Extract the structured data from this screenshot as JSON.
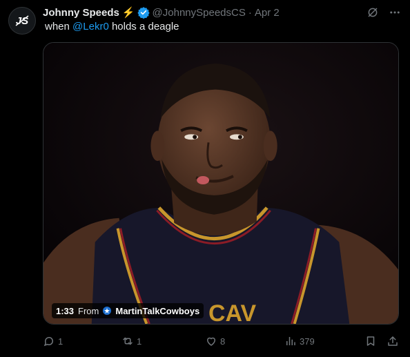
{
  "tweet": {
    "author_name": "Johnny Speeds",
    "author_emoji": "⚡",
    "handle": "@JohnnySpeedsCS",
    "separator": "·",
    "date": "Apr 2",
    "text_before": "when ",
    "mention": "@Lekr0",
    "text_after": " holds a deagle"
  },
  "media": {
    "duration": "1:33",
    "from_label": "From",
    "source_name": "MartinTalkCowboys"
  },
  "actions": {
    "replies": "1",
    "reposts": "1",
    "likes": "8",
    "views": "379"
  },
  "icons": {
    "avatar": "js-logo-icon",
    "verified": "verified-badge-icon",
    "grok": "grok-icon",
    "more": "more-icon",
    "reply": "reply-icon",
    "repost": "repost-icon",
    "like": "heart-icon",
    "views": "views-icon",
    "bookmark": "bookmark-icon",
    "share": "share-icon"
  },
  "colors": {
    "background": "#000000",
    "text": "#e7e9ea",
    "muted": "#71767b",
    "accent": "#1d9bf0",
    "verified": "#1d9bf0"
  }
}
